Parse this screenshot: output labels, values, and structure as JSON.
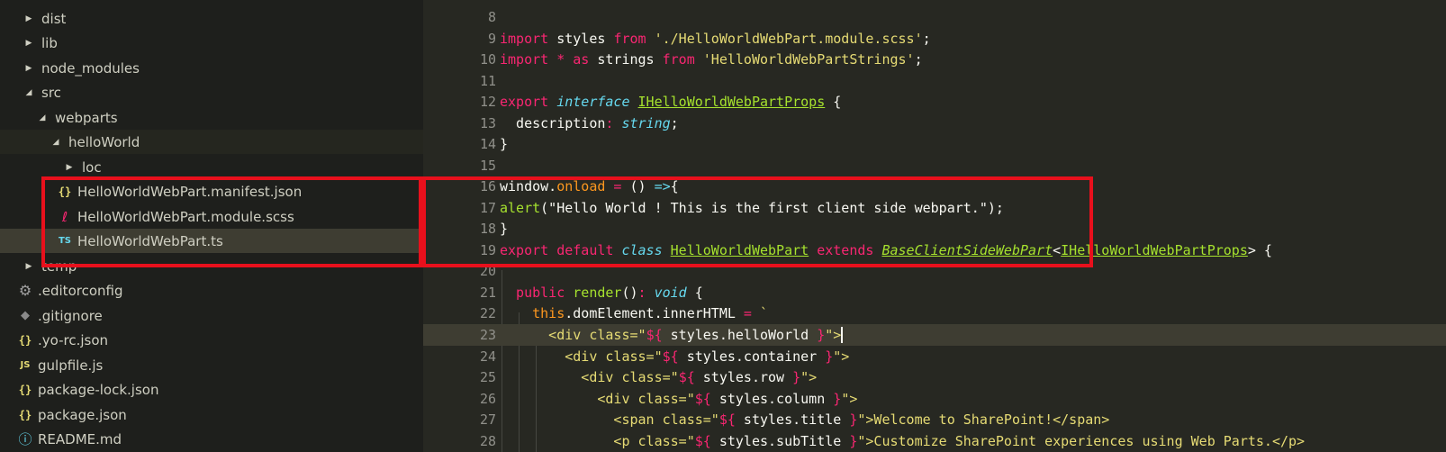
{
  "explorer": {
    "items": [
      {
        "label": "dist",
        "kind": "folder-collapsed",
        "icon": "chevron-right-icon"
      },
      {
        "label": "lib",
        "kind": "folder-collapsed",
        "icon": "chevron-right-icon"
      },
      {
        "label": "node_modules",
        "kind": "folder-collapsed",
        "icon": "chevron-right-icon"
      },
      {
        "label": "src",
        "kind": "folder-expanded",
        "icon": "chevron-down-icon"
      },
      {
        "label": "webparts",
        "kind": "folder-expanded",
        "icon": "chevron-down-icon"
      },
      {
        "label": "helloWorld",
        "kind": "folder-expanded",
        "icon": "chevron-down-icon"
      },
      {
        "label": "loc",
        "kind": "folder-collapsed",
        "icon": "chevron-right-icon"
      },
      {
        "label": "HelloWorldWebPart.manifest.json",
        "kind": "file",
        "icon": "json-file-icon"
      },
      {
        "label": "HelloWorldWebPart.module.scss",
        "kind": "file",
        "icon": "scss-file-icon"
      },
      {
        "label": "HelloWorldWebPart.ts",
        "kind": "file",
        "icon": "ts-file-icon"
      },
      {
        "label": "temp",
        "kind": "folder-collapsed",
        "icon": "chevron-right-icon"
      },
      {
        "label": ".editorconfig",
        "kind": "file",
        "icon": "gear-icon"
      },
      {
        "label": ".gitignore",
        "kind": "file",
        "icon": "git-icon"
      },
      {
        "label": ".yo-rc.json",
        "kind": "file",
        "icon": "json-file-icon"
      },
      {
        "label": "gulpfile.js",
        "kind": "file",
        "icon": "js-file-icon"
      },
      {
        "label": "package-lock.json",
        "kind": "file",
        "icon": "json-file-icon"
      },
      {
        "label": "package.json",
        "kind": "file",
        "icon": "json-file-icon"
      },
      {
        "label": "README.md",
        "kind": "file",
        "icon": "info-icon"
      }
    ],
    "icon_glyphs": {
      "json": "{}",
      "ts": "TS",
      "js": "JS"
    }
  },
  "editor": {
    "line_numbers": [
      "8",
      "9",
      "10",
      "11",
      "12",
      "13",
      "14",
      "15",
      "16",
      "17",
      "18",
      "19",
      "20",
      "21",
      "22",
      "23",
      "24",
      "25",
      "26",
      "27",
      "28"
    ],
    "tokens": {
      "l9_import": "import",
      "l9_styles": " styles ",
      "l9_from": "from",
      "l9_path": " './HelloWorldWebPart.module.scss'",
      "l9_semi": ";",
      "l10_import": "import",
      "l10_star": " * ",
      "l10_as": "as",
      "l10_strings": " strings ",
      "l10_from": "from",
      "l10_path": " 'HelloWorldWebPartStrings'",
      "l10_semi": ";",
      "l12_export": "export",
      "l12_interface": " interface",
      "l12_name": "IHelloWorldWebPartProps",
      "l12_brace": " {",
      "l13_desc": "  description",
      "l13_colon": ":",
      "l13_type": " string",
      "l13_semi": ";",
      "l14": "}",
      "l16_window": "window.",
      "l16_onload": "onload",
      "l16_eq": " = ",
      "l16_parens": "() ",
      "l16_arrow": "=>",
      "l16_brace": "{",
      "l17_alert": "alert",
      "l17_rest": "(\"Hello World ! This is the first client side webpart.\");",
      "l18": "}",
      "l19_export": "export",
      "l19_default": " default",
      "l19_class": " class",
      "l19_name": "HelloWorldWebPart",
      "l19_extends": " extends",
      "l19_base": "BaseClientSideWebPart",
      "l19_lt": "<",
      "l19_props": "IHelloWorldWebPartProps",
      "l19_gt": "> {",
      "l21_public": "  public",
      "l21_render": " render",
      "l21_paren": "()",
      "l21_colon": ":",
      "l21_void": " void",
      "l21_brace": " {",
      "l22_this": "    this",
      "l22_dom": ".domElement.innerHTML",
      "l22_eq": " = ",
      "l22_tick": "`",
      "l23_tag": "      <div class=\"",
      "l23_dollar": "${",
      "l23_expr": " styles.helloWorld ",
      "l23_close": "}",
      "l23_end": "\">",
      "l24_tag": "        <div class=\"",
      "l24_dollar": "${",
      "l24_expr": " styles.container ",
      "l24_close": "}",
      "l24_end": "\">",
      "l25_tag": "          <div class=\"",
      "l25_dollar": "${",
      "l25_expr": " styles.row ",
      "l25_close": "}",
      "l25_end": "\">",
      "l26_tag": "            <div class=\"",
      "l26_dollar": "${",
      "l26_expr": " styles.column ",
      "l26_close": "}",
      "l26_end": "\">",
      "l27_tag": "              <span class=\"",
      "l27_dollar": "${",
      "l27_expr": " styles.title ",
      "l27_close": "}",
      "l27_end": "\">Welcome to SharePoint!</span>",
      "l28_tag": "              <p class=\"",
      "l28_dollar": "${",
      "l28_expr": " styles.subTitle ",
      "l28_close": "}",
      "l28_end": "\">Customize SharePoint experiences using Web Parts.</p>"
    }
  },
  "colors": {
    "highlight_box": "#e8101c",
    "editor_bg": "#272822",
    "sidebar_bg": "#1e1f1c"
  }
}
